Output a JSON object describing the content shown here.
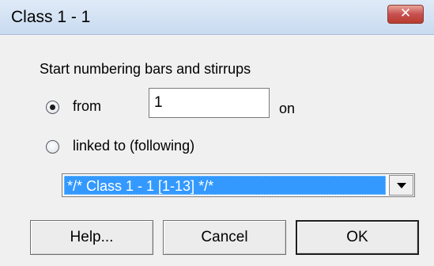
{
  "window": {
    "title": "Class 1 - 1",
    "close_glyph": "✕"
  },
  "numbering": {
    "heading": "Start numbering bars and stirrups",
    "from_label": "from",
    "from_value": "1",
    "on_label": "on",
    "linked_label": "linked to (following)",
    "selected_option": "from",
    "linked_selection": "*/* Class 1 - 1 [1-13] */*"
  },
  "buttons": {
    "help": "Help...",
    "cancel": "Cancel",
    "ok": "OK"
  },
  "colors": {
    "selection": "#3399ff",
    "close_button": "#c75050"
  }
}
